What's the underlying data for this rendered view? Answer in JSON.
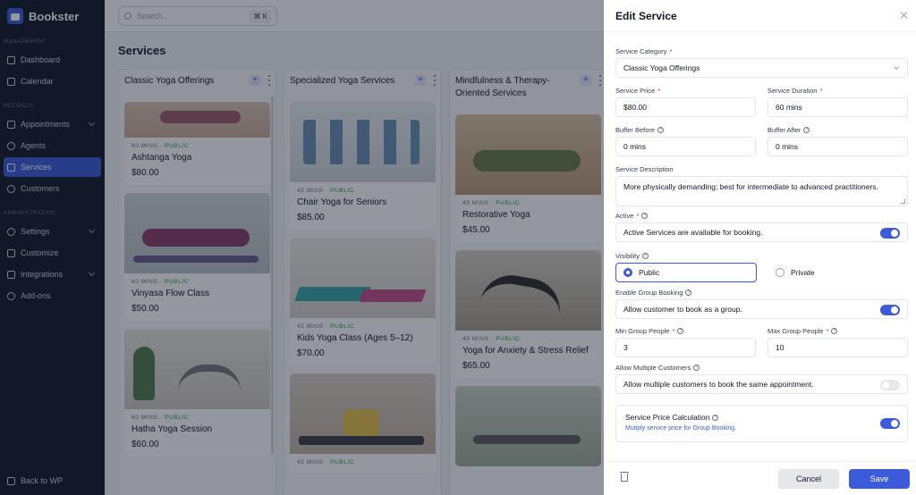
{
  "app": {
    "name": "Bookster"
  },
  "sidebar": {
    "sections": [
      {
        "label": "MANAGEMENT"
      },
      {
        "label": "RECORDS"
      },
      {
        "label": "ADMINISTRATION"
      }
    ],
    "items": [
      {
        "label": "Dashboard",
        "icon": "home-icon"
      },
      {
        "label": "Calendar",
        "icon": "calendar-icon"
      },
      {
        "label": "Appointments",
        "icon": "appointments-icon"
      },
      {
        "label": "Agents",
        "icon": "user-icon"
      },
      {
        "label": "Services",
        "icon": "cube-icon",
        "active": true
      },
      {
        "label": "Customers",
        "icon": "users-icon"
      },
      {
        "label": "Settings",
        "icon": "gear-icon"
      },
      {
        "label": "Customize",
        "icon": "sliders-icon"
      },
      {
        "label": "Integrations",
        "icon": "plug-icon"
      },
      {
        "label": "Add-ons",
        "icon": "power-icon"
      }
    ],
    "back": "Back to WP"
  },
  "topbar": {
    "search_placeholder": "Search...",
    "shortcut": "⌘ K"
  },
  "page": {
    "title": "Services"
  },
  "columns": [
    {
      "title": "Classic Yoga Offerings",
      "cards": [
        {
          "duration": "60 MINS",
          "visibility": "PUBLIC",
          "name": "Ashtanga Yoga",
          "price": "$80.00"
        },
        {
          "duration": "60 MINS",
          "visibility": "PUBLIC",
          "name": "Vinyasa Flow Class",
          "price": "$50.00"
        },
        {
          "duration": "60 MINS",
          "visibility": "PUBLIC",
          "name": "Hatha Yoga Session",
          "price": "$60.00"
        }
      ]
    },
    {
      "title": "Specialized Yoga Services",
      "cards": [
        {
          "duration": "45 MINS",
          "visibility": "PUBLIC",
          "name": "Chair Yoga for Seniors",
          "price": "$85.00"
        },
        {
          "duration": "45 MINS",
          "visibility": "PUBLIC",
          "name": "Kids Yoga Class (Ages 5–12)",
          "price": "$70.00"
        },
        {
          "duration": "45 MINS",
          "visibility": "PUBLIC",
          "name": "",
          "price": ""
        }
      ]
    },
    {
      "title": "Mindfulness & Therapy-Oriented Services",
      "cards": [
        {
          "duration": "45 MINS",
          "visibility": "PUBLIC",
          "name": "Restorative Yoga",
          "price": "$45.00"
        },
        {
          "duration": "45 MINS",
          "visibility": "PUBLIC",
          "name": "Yoga for Anxiety & Stress Relief",
          "price": "$65.00"
        },
        {
          "duration": "",
          "visibility": "",
          "name": "",
          "price": ""
        }
      ]
    }
  ],
  "drawer": {
    "title": "Edit Service",
    "category": {
      "label": "Service Category",
      "value": "Classic Yoga Offerings"
    },
    "price": {
      "label": "Service Price",
      "value": "$80.00"
    },
    "duration": {
      "label": "Service Duration",
      "value": "60 mins"
    },
    "buffer_before": {
      "label": "Buffer Before",
      "value": "0 mins"
    },
    "buffer_after": {
      "label": "Buffer After",
      "value": "0 mins"
    },
    "description": {
      "label": "Service Description",
      "value": "More physically demanding; best for intermediate to advanced practitioners."
    },
    "active": {
      "label": "Active",
      "text": "Active Services are available for booking.",
      "on": true
    },
    "visibility": {
      "label": "Visibility",
      "options": [
        "Public",
        "Private"
      ],
      "selected": "Public"
    },
    "group_booking": {
      "label": "Enable Group Booking",
      "text": "Allow customer to book as a group.",
      "on": true
    },
    "min_group": {
      "label": "Min Group People",
      "value": "3"
    },
    "max_group": {
      "label": "Max Group People",
      "value": "10"
    },
    "multiple_customers": {
      "label": "Allow Multiple Customers",
      "text": "Allow multiple customers to book the same appointment.",
      "on": false
    },
    "price_calc": {
      "title": "Service Price Calculation",
      "subtitle": "Mutiply service price for Group Booking.",
      "on": true
    },
    "cancel": "Cancel",
    "save": "Save"
  },
  "colors": {
    "accent": "#3b5bdb",
    "sidebar_bg": "#111827",
    "public_green": "#16a34a",
    "required_red": "#dc2626"
  }
}
